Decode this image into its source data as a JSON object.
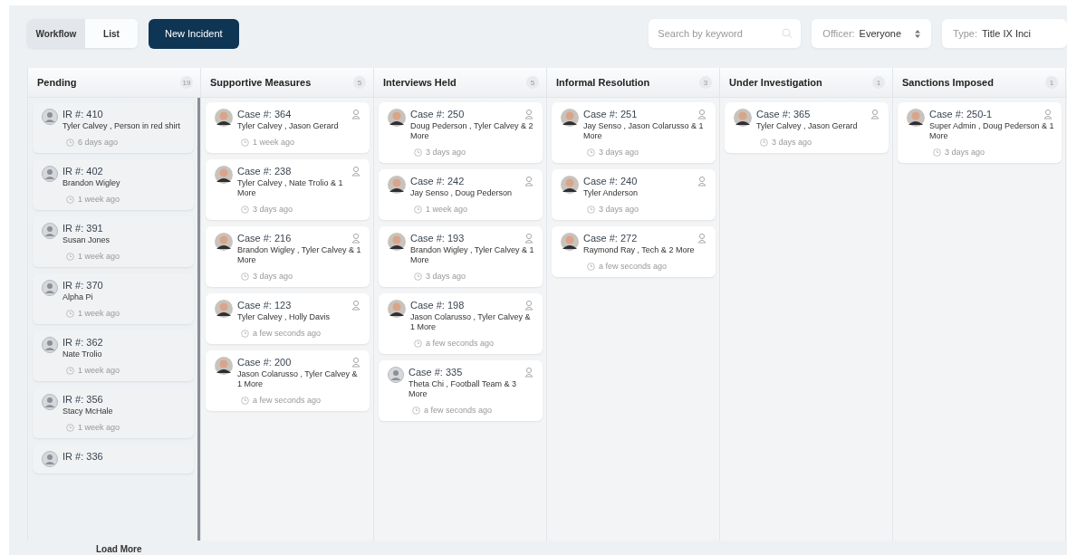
{
  "view_toggle": [
    {
      "label": "Workflow",
      "selected": true
    },
    {
      "label": "List",
      "selected": false
    }
  ],
  "new_button": "New Incident",
  "search": {
    "placeholder": "Search by keyword"
  },
  "officer_filter": {
    "label": "Officer:",
    "value": "Everyone"
  },
  "type_filter": {
    "label": "Type:",
    "value": "Title IX Inci"
  },
  "columns": [
    {
      "title": "Pending",
      "count": "19",
      "kind": "intake",
      "cards": [
        {
          "number": "IR #: 410",
          "kind": "placeholder",
          "people": "Tyler Calvey , Person in red shirt",
          "time": "6 days ago"
        },
        {
          "number": "IR #: 402",
          "kind": "placeholder",
          "people": "Brandon Wigley",
          "time": "1 week ago"
        },
        {
          "number": "IR #: 391",
          "kind": "placeholder",
          "people": "Susan Jones",
          "time": "1 week ago"
        },
        {
          "number": "IR #: 370",
          "kind": "placeholder",
          "people": "Alpha Pi",
          "time": "1 week ago"
        },
        {
          "number": "IR #: 362",
          "kind": "placeholder",
          "people": "Nate Trolio",
          "time": "1 week ago"
        },
        {
          "number": "IR #: 356",
          "kind": "placeholder",
          "people": "Stacy McHale",
          "time": "1 week ago"
        },
        {
          "number": "IR #: 336",
          "kind": "placeholder"
        }
      ]
    },
    {
      "title": "Supportive Measures",
      "count": "5",
      "kind": "case",
      "cards": [
        {
          "number": "Case #: 364",
          "people": "Tyler Calvey , Jason Gerard",
          "time": "1 week ago"
        },
        {
          "number": "Case #: 238",
          "people": "Tyler Calvey , Nate Trolio & 1 More",
          "time": "3 days ago"
        },
        {
          "number": "Case #: 216",
          "people": "Brandon Wigley , Tyler Calvey & 1 More",
          "time": "3 days ago"
        },
        {
          "number": "Case #: 123",
          "people": "Tyler Calvey , Holly Davis",
          "time": "a few seconds ago"
        },
        {
          "number": "Case #: 200",
          "people": "Jason Colarusso , Tyler Calvey & 1 More",
          "time": "a few seconds ago"
        }
      ]
    },
    {
      "title": "Interviews Held",
      "count": "5",
      "kind": "case",
      "cards": [
        {
          "number": "Case #: 250",
          "people": "Doug Pederson , Tyler Calvey & 2 More",
          "time": "3 days ago"
        },
        {
          "number": "Case #: 242",
          "people": "Jay Senso , Doug Pederson",
          "time": "1 week ago"
        },
        {
          "number": "Case #: 193",
          "people": "Brandon Wigley , Tyler Calvey & 1 More",
          "time": "3 days ago"
        },
        {
          "number": "Case #: 198",
          "people": "Jason Colarusso , Tyler Calvey & 1 More",
          "time": "a few seconds ago"
        },
        {
          "number": "Case #: 335",
          "kind": "placeholder",
          "people": "Theta Chi , Football Team & 3 More",
          "time": "a few seconds ago"
        }
      ]
    },
    {
      "title": "Informal Resolution",
      "count": "3",
      "kind": "case",
      "cards": [
        {
          "number": "Case #: 251",
          "people": "Jay Senso , Jason Colarusso & 1 More",
          "time": "3 days ago"
        },
        {
          "number": "Case #: 240",
          "people": "Tyler Anderson",
          "time": "3 days ago"
        },
        {
          "number": "Case #: 272",
          "people": "Raymond Ray , Tech & 2 More",
          "time": "a few seconds ago"
        }
      ]
    },
    {
      "title": "Under Investigation",
      "count": "1",
      "kind": "case",
      "cards": [
        {
          "number": "Case #: 365",
          "people": "Tyler Calvey , Jason Gerard",
          "time": "3 days ago"
        }
      ]
    },
    {
      "title": "Sanctions Imposed",
      "count": "1",
      "kind": "case",
      "cards": [
        {
          "number": "Case #: 250-1",
          "people": "Super Admin , Doug Pederson & 1 More",
          "time": "3 days ago"
        }
      ]
    }
  ],
  "load_more": "Load More"
}
